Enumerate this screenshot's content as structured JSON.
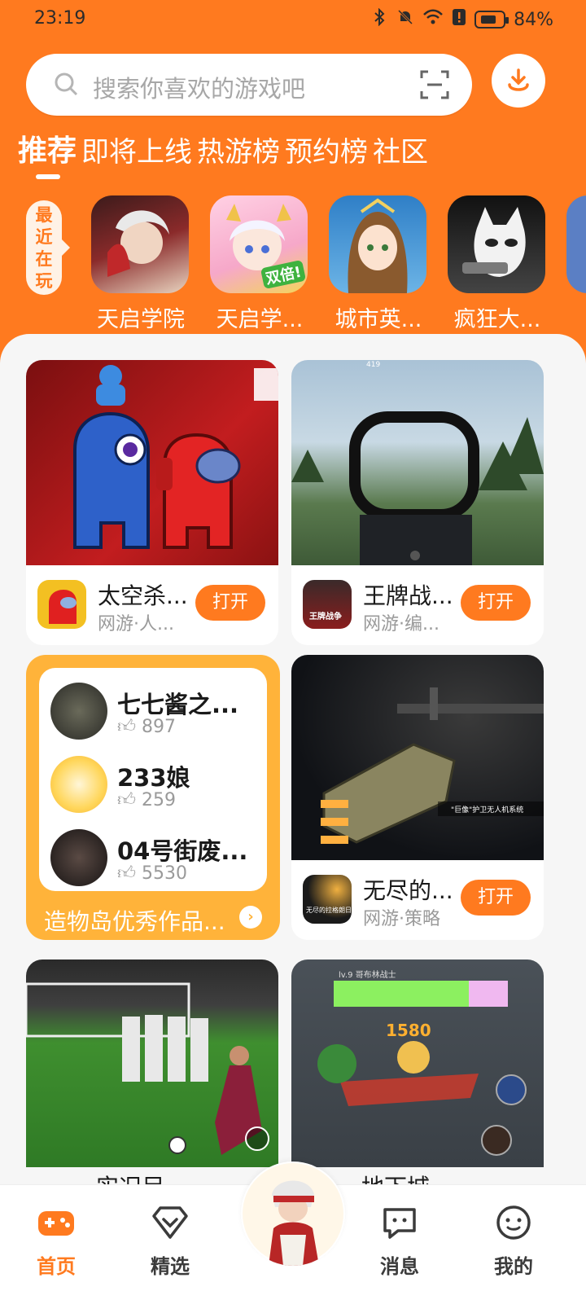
{
  "status_bar": {
    "time": "23:19",
    "battery": "84%"
  },
  "search": {
    "placeholder": "搜索你喜欢的游戏吧"
  },
  "tabs": [
    {
      "label": "推荐",
      "active": true
    },
    {
      "label": "即将上线",
      "active": false
    },
    {
      "label": "热游榜",
      "active": false
    },
    {
      "label": "预约榜",
      "active": false
    },
    {
      "label": "社区",
      "active": false
    }
  ],
  "recent": {
    "label": "最近在玩",
    "games": [
      {
        "name": "天启学院",
        "color": "#7a2a2a"
      },
      {
        "name": "天启学...",
        "color": "#f1a3c6",
        "badge": "双倍!"
      },
      {
        "name": "城市英...",
        "color": "#3e88c9"
      },
      {
        "name": "疯狂大...",
        "color": "#d9d9d9"
      }
    ]
  },
  "cards": [
    {
      "title": "太空杀...",
      "sub": "网游·人...",
      "button": "打开"
    },
    {
      "title": "王牌战...",
      "sub": "网游·编...",
      "button": "打开"
    },
    {
      "title": "无尽的...",
      "sub": "网游·策略",
      "button": "打开"
    }
  ],
  "card_art_text": {
    "shooter_top": "419",
    "space_caption": "\"巨像\"护卫无人机系统",
    "strategy_app_icon": "无尽的拉格朗日",
    "fps_app_icon": "王牌战争",
    "rpg_level": "lv.9 哥布林战士",
    "rpg_damage": "1580"
  },
  "works": {
    "items": [
      {
        "name": "七七酱之...",
        "likes": "897"
      },
      {
        "name": "233娘",
        "likes": "259"
      },
      {
        "name": "04号街废...",
        "likes": "5530"
      }
    ],
    "footer": "造物岛优秀作品..."
  },
  "partial_titles": [
    "实况足...",
    "地下城..."
  ],
  "nav": [
    {
      "label": "首页",
      "active": true
    },
    {
      "label": "精选",
      "active": false
    },
    {
      "label": "消息",
      "active": false
    },
    {
      "label": "我的",
      "active": false
    }
  ],
  "colors": {
    "brand_orange": "#ff7a1f",
    "works_yellow": "#ffb33a"
  }
}
